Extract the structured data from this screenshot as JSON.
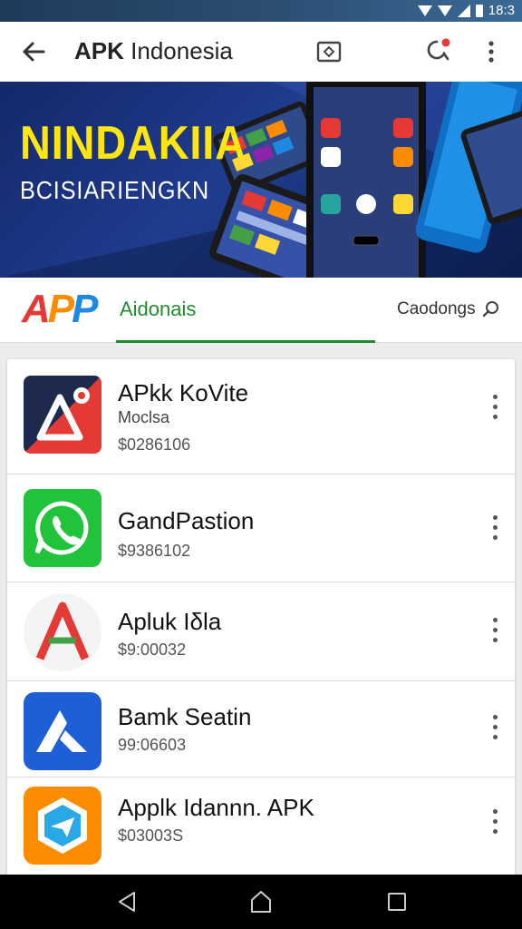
{
  "status_bar": {
    "time": "18:3"
  },
  "app_bar": {
    "title_bold": "APK",
    "title_rest": " Indonesia"
  },
  "banner": {
    "headline": "NINDAKIIA",
    "subline": "BCISIARIENGKN"
  },
  "tabs": {
    "logo": {
      "a": "A",
      "p1": "P",
      "p2": "P"
    },
    "active_label": "Aidonais",
    "search_label": "Caodongs"
  },
  "apps": [
    {
      "name": "APkk KoVite",
      "category": "Moclsa",
      "price": "$0286106"
    },
    {
      "name": "GandPastion",
      "category": "",
      "price": "$9386102"
    },
    {
      "name": "Apluk Iδla",
      "category": "",
      "price": "$9:00032"
    },
    {
      "name": "Bamk Seatin",
      "category": "",
      "price": "99:06603"
    },
    {
      "name": "Applk Idannn. APK",
      "category": "",
      "price": "$03003S"
    }
  ],
  "colors": {
    "accent_green": "#1e8c2e",
    "banner_yellow": "#ffe60f",
    "banner_blue": "#1f3c8e"
  }
}
